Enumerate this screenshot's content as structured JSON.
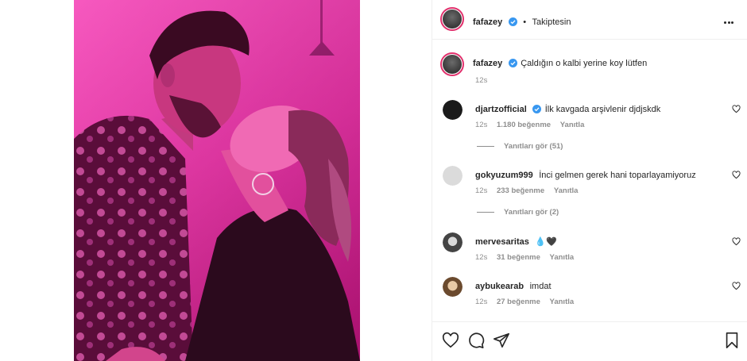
{
  "post": {
    "image_alt": "Pink-lit photo of a couple",
    "author": {
      "username": "fafazey",
      "verified": true,
      "follow_status": "Takiptesin",
      "separator": "•"
    },
    "caption": {
      "username": "fafazey",
      "text": "Çaldığın o kalbi yerine koy lütfen",
      "time": "12s"
    },
    "comments": [
      {
        "username": "djartzofficial",
        "verified": true,
        "text": "İlk kavgada arşivlenir djdjskdk",
        "time": "12s",
        "likes": "1.180 beğenme",
        "reply_label": "Yanıtla",
        "view_replies": "Yanıtları gör (51)",
        "avatar_color": "#1a1a1a"
      },
      {
        "username": "gokyuzum999",
        "verified": false,
        "text": "İnci gelmen gerek hani toparlayamiyoruz",
        "time": "12s",
        "likes": "233 beğenme",
        "reply_label": "Yanıtla",
        "view_replies": "Yanıtları gör (2)",
        "avatar_color": "#dbdbdb"
      },
      {
        "username": "mervesaritas",
        "verified": false,
        "text": "💧🖤",
        "time": "12s",
        "likes": "31 beğenme",
        "reply_label": "Yanıtla",
        "view_replies": "",
        "avatar_color": "#444444"
      },
      {
        "username": "aybukearab",
        "verified": false,
        "text": "imdat",
        "time": "12s",
        "likes": "27 beğenme",
        "reply_label": "Yanıtla",
        "view_replies": "",
        "avatar_color": "#8a6a4a"
      }
    ]
  },
  "icons": {
    "like": "heart-icon",
    "comment": "comment-icon",
    "share": "paper-plane-icon",
    "save": "bookmark-icon",
    "more": "more-options-icon",
    "verified": "verified-badge-icon"
  },
  "colors": {
    "verified": "#3897f0",
    "text": "#262626",
    "muted": "#8e8e8e",
    "border": "#efefef",
    "photo_pink": "#ea2fa5"
  }
}
